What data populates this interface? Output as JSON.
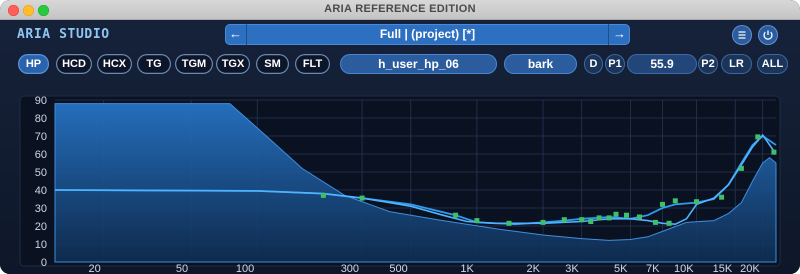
{
  "window": {
    "title": "ARIA REFERENCE EDITION"
  },
  "brand": "ARIA STUDIO",
  "preset": {
    "name": "Full | (project) [*]",
    "prev_icon": "arrow-left-icon",
    "next_icon": "arrow-right-icon"
  },
  "header_buttons": {
    "menu_icon": "hamburger-menu-icon",
    "power_icon": "power-icon"
  },
  "filter_buttons": [
    "HP",
    "HCD",
    "HCX",
    "TG",
    "TGM",
    "TGX",
    "SM",
    "FLT"
  ],
  "active_filter": "HP",
  "controls": {
    "file_name": "h_user_hp_06",
    "scale": "bark",
    "d_label": "D",
    "p1_label": "P1",
    "value": "55.9",
    "p2_label": "P2",
    "lr_label": "LR",
    "all_label": "ALL"
  },
  "colors": {
    "accent": "#2a62ad",
    "curve": "#4aa8f5",
    "node": "#3fbf6a",
    "fill": "#1b5a9c"
  },
  "chart_data": {
    "type": "line",
    "x_scale": "log",
    "x_ticks": [
      "20",
      "50",
      "100",
      "300",
      "500",
      "1K",
      "2K",
      "3K",
      "5K",
      "7K",
      "10K",
      "15K",
      "20K"
    ],
    "x_tick_values": [
      20,
      50,
      100,
      300,
      500,
      1000,
      2000,
      3000,
      5000,
      7000,
      10000,
      15000,
      20000
    ],
    "y_ticks": [
      "0",
      "10",
      "20",
      "30",
      "40",
      "50",
      "60",
      "70",
      "80",
      "90"
    ],
    "ylim": [
      0,
      90
    ],
    "xlim": [
      12,
      23000
    ],
    "series": [
      {
        "role": "filter-fill",
        "points": [
          [
            12,
            88
          ],
          [
            75,
            88
          ],
          [
            110,
            70
          ],
          [
            160,
            52
          ],
          [
            250,
            37
          ],
          [
            400,
            28
          ],
          [
            700,
            23
          ],
          [
            1300,
            18
          ],
          [
            2000,
            15
          ],
          [
            3000,
            13
          ],
          [
            4000,
            12
          ],
          [
            5000,
            12.5
          ],
          [
            6000,
            14
          ],
          [
            7000,
            17
          ],
          [
            9000,
            22
          ],
          [
            12000,
            23
          ],
          [
            14000,
            27
          ],
          [
            16000,
            33
          ],
          [
            18000,
            45
          ],
          [
            20000,
            55
          ],
          [
            21500,
            58
          ],
          [
            23000,
            55
          ]
        ]
      },
      {
        "role": "measured-response",
        "points": [
          [
            12,
            40
          ],
          [
            100,
            39.5
          ],
          [
            200,
            38
          ],
          [
            300,
            35.5
          ],
          [
            500,
            32
          ],
          [
            800,
            26
          ],
          [
            1000,
            22
          ],
          [
            1500,
            21
          ],
          [
            2000,
            22
          ],
          [
            2500,
            23
          ],
          [
            3000,
            24
          ],
          [
            3500,
            24.5
          ],
          [
            4000,
            25
          ],
          [
            5000,
            24
          ],
          [
            6000,
            26
          ],
          [
            7000,
            30
          ],
          [
            8000,
            32
          ],
          [
            10000,
            33
          ],
          [
            12000,
            35
          ],
          [
            14000,
            43
          ],
          [
            16000,
            55
          ],
          [
            18000,
            65
          ],
          [
            20000,
            70
          ],
          [
            23000,
            65
          ]
        ]
      },
      {
        "role": "target-response",
        "points": [
          [
            12,
            40
          ],
          [
            100,
            39.5
          ],
          [
            200,
            38
          ],
          [
            300,
            35.5
          ],
          [
            500,
            31
          ],
          [
            700,
            26
          ],
          [
            900,
            22.5
          ],
          [
            1200,
            21.5
          ],
          [
            2000,
            21.5
          ],
          [
            3000,
            22.5
          ],
          [
            4000,
            24
          ],
          [
            5000,
            24
          ],
          [
            6000,
            23
          ],
          [
            7000,
            21.5
          ],
          [
            8000,
            21
          ],
          [
            9000,
            24
          ],
          [
            10000,
            32
          ],
          [
            12000,
            35.5
          ],
          [
            14000,
            43
          ],
          [
            16000,
            54
          ],
          [
            18000,
            64
          ],
          [
            20000,
            70.5
          ],
          [
            23000,
            60
          ]
        ]
      }
    ],
    "nodes": [
      [
        200,
        37
      ],
      [
        300,
        35.5
      ],
      [
        800,
        26
      ],
      [
        1000,
        23
      ],
      [
        1400,
        21.5
      ],
      [
        2000,
        22
      ],
      [
        2500,
        23.5
      ],
      [
        3000,
        23.5
      ],
      [
        3600,
        24.5
      ],
      [
        4300,
        26.5
      ],
      [
        4800,
        26
      ],
      [
        5500,
        25
      ],
      [
        7000,
        32
      ],
      [
        8000,
        34
      ],
      [
        10000,
        33.5
      ],
      [
        13000,
        36
      ],
      [
        16000,
        52
      ],
      [
        19000,
        69.5
      ],
      [
        22500,
        61
      ],
      [
        6500,
        22
      ],
      [
        7500,
        21.5
      ],
      [
        3300,
        22.5
      ],
      [
        4000,
        24.5
      ]
    ]
  }
}
